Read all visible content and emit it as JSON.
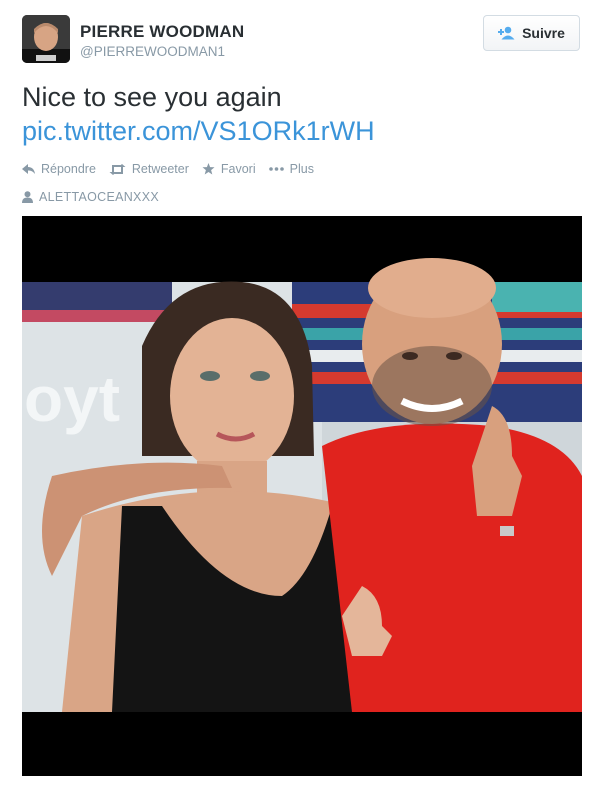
{
  "author": {
    "full_name": "PIERRE WOODMAN",
    "screen_name": "@PIERREWOODMAN1"
  },
  "follow_button": {
    "label": "Suivre",
    "icon": "person-plus-icon"
  },
  "tweet": {
    "text": "Nice to see you again",
    "link": "pic.twitter.com/VS1ORk1rWH"
  },
  "actions": [
    {
      "label": "Répondre",
      "icon": "reply-icon"
    },
    {
      "label": "Retweeter",
      "icon": "retweet-icon"
    },
    {
      "label": "Favori",
      "icon": "star-icon"
    },
    {
      "label": "Plus",
      "icon": "more-dots-icon"
    }
  ],
  "tagged_user": {
    "label": "ALETTAOCEANXXX",
    "icon": "person-icon"
  },
  "colors": {
    "link": "#3b94d9",
    "muted": "#8899a6",
    "text": "#292f33",
    "shirt_red": "#e0231e"
  }
}
